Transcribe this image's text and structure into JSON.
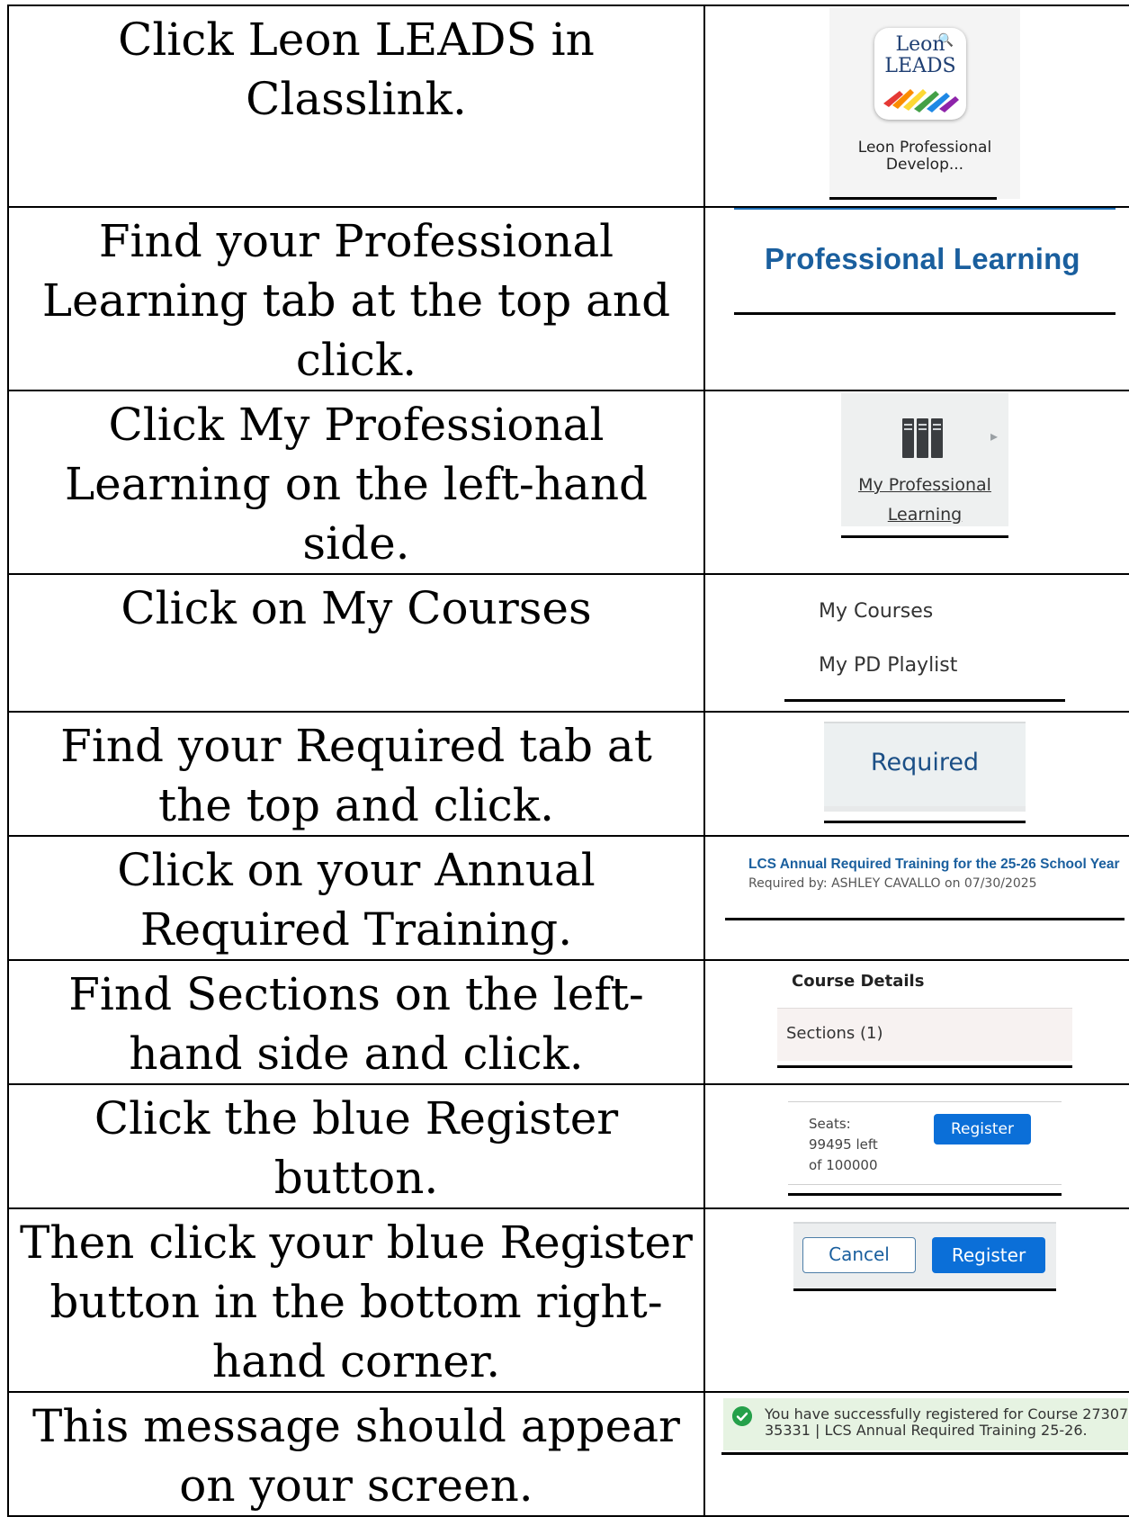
{
  "steps": [
    {
      "instruction": "Click Leon LEADS in Classlink."
    },
    {
      "instruction": "Find your Professional Learning tab at the top and click."
    },
    {
      "instruction": "Click My Professional Learning on the left-hand side."
    },
    {
      "instruction": "Click on My Courses"
    },
    {
      "instruction": "Find your Required tab at the top and click."
    },
    {
      "instruction": "Click on your Annual Required Training."
    },
    {
      "instruction": "Find Sections on the left-hand side and click."
    },
    {
      "instruction": "Click the blue Register button."
    },
    {
      "instruction": "Then click your blue Register button in the bottom right-hand corner."
    },
    {
      "instruction": "This message should appear on your screen."
    }
  ],
  "screens": {
    "app_tile": {
      "logo_line1": "Leon",
      "logo_line2": "LEADS",
      "name_line1": "Leon Professional",
      "name_line2": "Develop..."
    },
    "pl_tab": {
      "label": "Professional Learning"
    },
    "my_pl": {
      "line1": "My Professional",
      "line2": "Learning",
      "icon": "bookshelf-icon"
    },
    "menu": {
      "my_courses": "My Courses",
      "my_pd_playlist": "My PD Playlist"
    },
    "required_tab": {
      "label": "Required"
    },
    "course_item": {
      "title": "LCS Annual Required Training for the 25-26 School Year",
      "required_by": "Required by: ASHLEY CAVALLO on 07/30/2025"
    },
    "course_details": {
      "heading": "Course Details",
      "sections": "Sections (1)"
    },
    "seats": {
      "line1": "Seats:",
      "line2": "99495 left",
      "line3": "of 100000",
      "register": "Register"
    },
    "modal": {
      "cancel": "Cancel",
      "register": "Register"
    },
    "toast": {
      "line1": "You have successfully registered for Course 27307",
      "line2": "35331 | LCS Annual Required Training 25-26.",
      "icon": "check-circle-icon"
    }
  },
  "colors": {
    "accent_blue": "#0b6fd8",
    "link_blue": "#1a5f9e",
    "success_green": "#25a04a"
  }
}
